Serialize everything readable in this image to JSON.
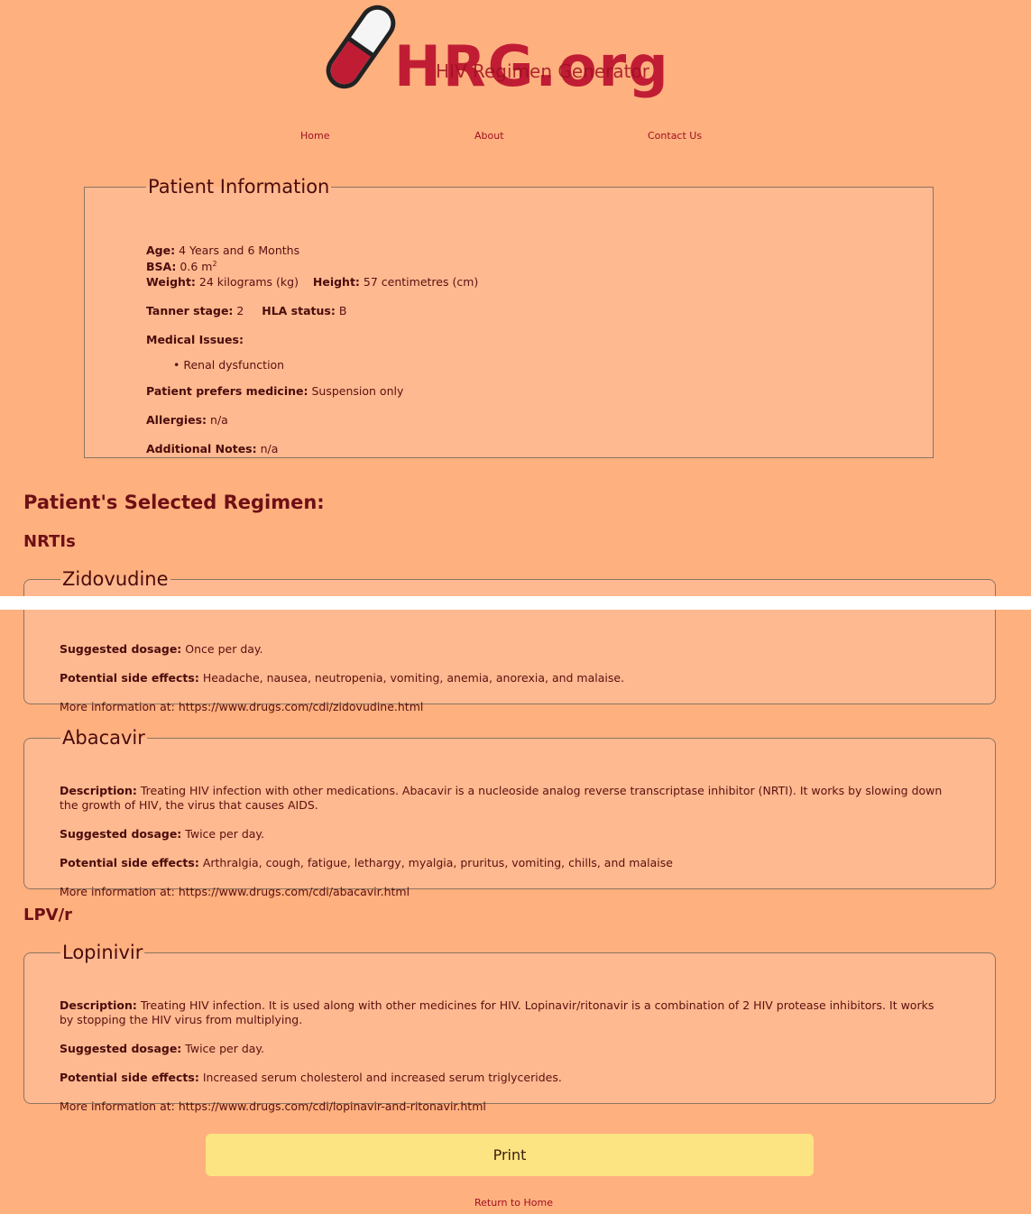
{
  "logo": {
    "main_text": "HRG.org",
    "sub_text": "HIV Regimen Generator"
  },
  "nav": {
    "home": "Home",
    "about": "About",
    "contact": "Contact Us"
  },
  "patient_info": {
    "legend": "Patient Information",
    "age_label": "Age:",
    "age_value": "4 Years and 6 Months",
    "bsa_label": "BSA:",
    "bsa_value": "0.6 m",
    "bsa_sup": "2",
    "weight_label": "Weight:",
    "weight_value": "24 kilograms (kg)",
    "height_label": "Height:",
    "height_value": "57 centimetres (cm)",
    "tanner_label": "Tanner stage:",
    "tanner_value": "2",
    "hla_label": "HLA status:",
    "hla_value": "B",
    "medical_issues_label": "Medical Issues:",
    "medical_issues": [
      "Renal dysfunction"
    ],
    "prefers_label": "Patient prefers medicine:",
    "prefers_value": "Suspension only",
    "allergies_label": "Allergies:",
    "allergies_value": "n/a",
    "notes_label": "Additional Notes:",
    "notes_value": "n/a"
  },
  "regimen": {
    "title": "Patient's Selected Regimen:",
    "groups": [
      {
        "name": "NRTIs",
        "drugs": [
          {
            "name": "Zidovudine",
            "dosage_label": "Suggested dosage:",
            "dosage": "Once per day.",
            "side_effects_label": "Potential side effects:",
            "side_effects": "Headache, nausea, neutropenia, vomiting, anemia, anorexia, and malaise.",
            "more_info": "More information at: https://www.drugs.com/cdi/zidovudine.html"
          },
          {
            "name": "Abacavir",
            "description_label": "Description:",
            "description": "Treating HIV infection with other medications. Abacavir is a nucleoside analog reverse transcriptase inhibitor (NRTI). It works by slowing down the growth of HIV, the virus that causes AIDS.",
            "dosage_label": "Suggested dosage:",
            "dosage": "Twice per day.",
            "side_effects_label": "Potential side effects:",
            "side_effects": "Arthralgia, cough, fatigue, lethargy, myalgia, pruritus, vomiting, chills, and malaise",
            "more_info": "More information at: https://www.drugs.com/cdi/abacavir.html"
          }
        ]
      },
      {
        "name": "LPV/r",
        "drugs": [
          {
            "name": "Lopinivir",
            "description_label": "Description:",
            "description": "Treating HIV infection. It is used along with other medicines for HIV. Lopinavir/ritonavir is a combination of 2 HIV protease inhibitors. It works by stopping the HIV virus from multiplying.",
            "dosage_label": "Suggested dosage:",
            "dosage": "Twice per day.",
            "side_effects_label": "Potential side effects:",
            "side_effects": "Increased serum cholesterol and increased serum triglycerides.",
            "more_info": "More information at: https://www.drugs.com/cdi/lopinavir-and-ritonavir.html"
          }
        ]
      }
    ]
  },
  "print_label": "Print",
  "return_home": "Return to Home",
  "colors": {
    "background": "#ffb07f",
    "panel": "#ffb990",
    "accent": "#c01d35",
    "button": "#fde482"
  }
}
